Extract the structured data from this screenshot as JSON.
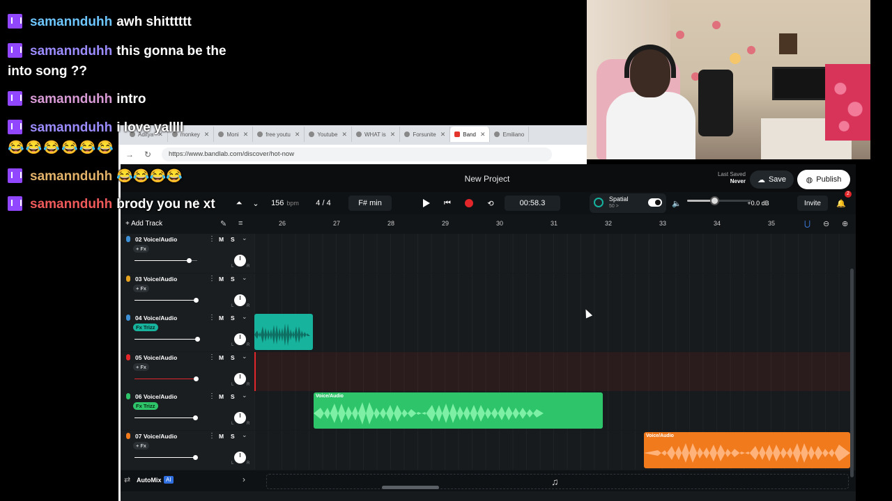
{
  "chat": {
    "messages": [
      {
        "user": "samannduhh",
        "color": "#6ec6ff",
        "text": "awh shitttttt"
      },
      {
        "user": "samannduhh",
        "color": "#9b8cff",
        "text": "this gonna be the into song ??"
      },
      {
        "user": "samannduhh",
        "color": "#d99bd6",
        "text": "intro"
      },
      {
        "user": "samannduhh",
        "color": "#9b8cff",
        "text": "i love yallll",
        "emojis": "😂😂😂😂😂😂"
      },
      {
        "user": "samannduhh",
        "color": "#e3b36a",
        "text": "😂😂😂😂"
      },
      {
        "user": "samannduhh",
        "color": "#f05a5a",
        "text": "brody you ne xt"
      }
    ]
  },
  "browser": {
    "tabs": [
      {
        "label": "Aditya"
      },
      {
        "label": "monkey"
      },
      {
        "label": "Moni"
      },
      {
        "label": "free youtu"
      },
      {
        "label": "Youtube"
      },
      {
        "label": "WHAT is"
      },
      {
        "label": "Forsunite"
      },
      {
        "label": "Band",
        "active": true
      },
      {
        "label": "Emiliano"
      }
    ],
    "url": "https://www.bandlab.com/discover/hot-now"
  },
  "studio": {
    "title": "New Project",
    "last_saved_label": "Last Saved",
    "last_saved_value": "Never",
    "save_label": "Save",
    "publish_label": "Publish",
    "bpm": "156",
    "bpm_unit": "bpm",
    "time_sig": "4 / 4",
    "key": "F# min",
    "time": "00:58.3",
    "spatial_label": "Spatial",
    "spatial_sub": "50 >",
    "master_gain": "+0.0 dB",
    "master_volume": 0.42,
    "invite_label": "Invite",
    "notifications": "2",
    "add_track_label": "Add Track",
    "ruler": [
      "26",
      "27",
      "28",
      "29",
      "30",
      "31",
      "32",
      "33",
      "34",
      "35"
    ],
    "automix_label": "AutoMix",
    "ai_label": "AI"
  },
  "tracks": [
    {
      "name": "02  Voice/Audio",
      "fx": "+ Fx",
      "mic": "#3d8fd6",
      "volume": 0.87
    },
    {
      "name": "03  Voice/Audio",
      "fx": "+ Fx",
      "mic": "#e6a21f",
      "volume": 0.98
    },
    {
      "name": "04  Voice/Audio",
      "fx": "Fx Trizz",
      "mic": "#3d8fd6",
      "volume": 1.2
    },
    {
      "name": "05  Voice/Audio",
      "fx": "+ Fx",
      "mic": "#e3262a",
      "volume": 0.98
    },
    {
      "name": "06  Voice/Audio",
      "fx": "Fx Trizz",
      "mic": "#2ec46a",
      "volume": 0.97
    },
    {
      "name": "07  Voice/Audio",
      "fx": "+ Fx",
      "mic": "#f07a1c",
      "volume": 0.97
    }
  ],
  "clips": [
    {
      "label": "Voice/Audio",
      "color": "#2ec46a"
    },
    {
      "label": "Voice/Audio",
      "color": "#f07a1c"
    }
  ],
  "colors": {
    "accent": "#e3262a",
    "teal": "#17b39d",
    "green": "#2ec46a",
    "orange": "#f07a1c",
    "background": "#161a1d"
  }
}
